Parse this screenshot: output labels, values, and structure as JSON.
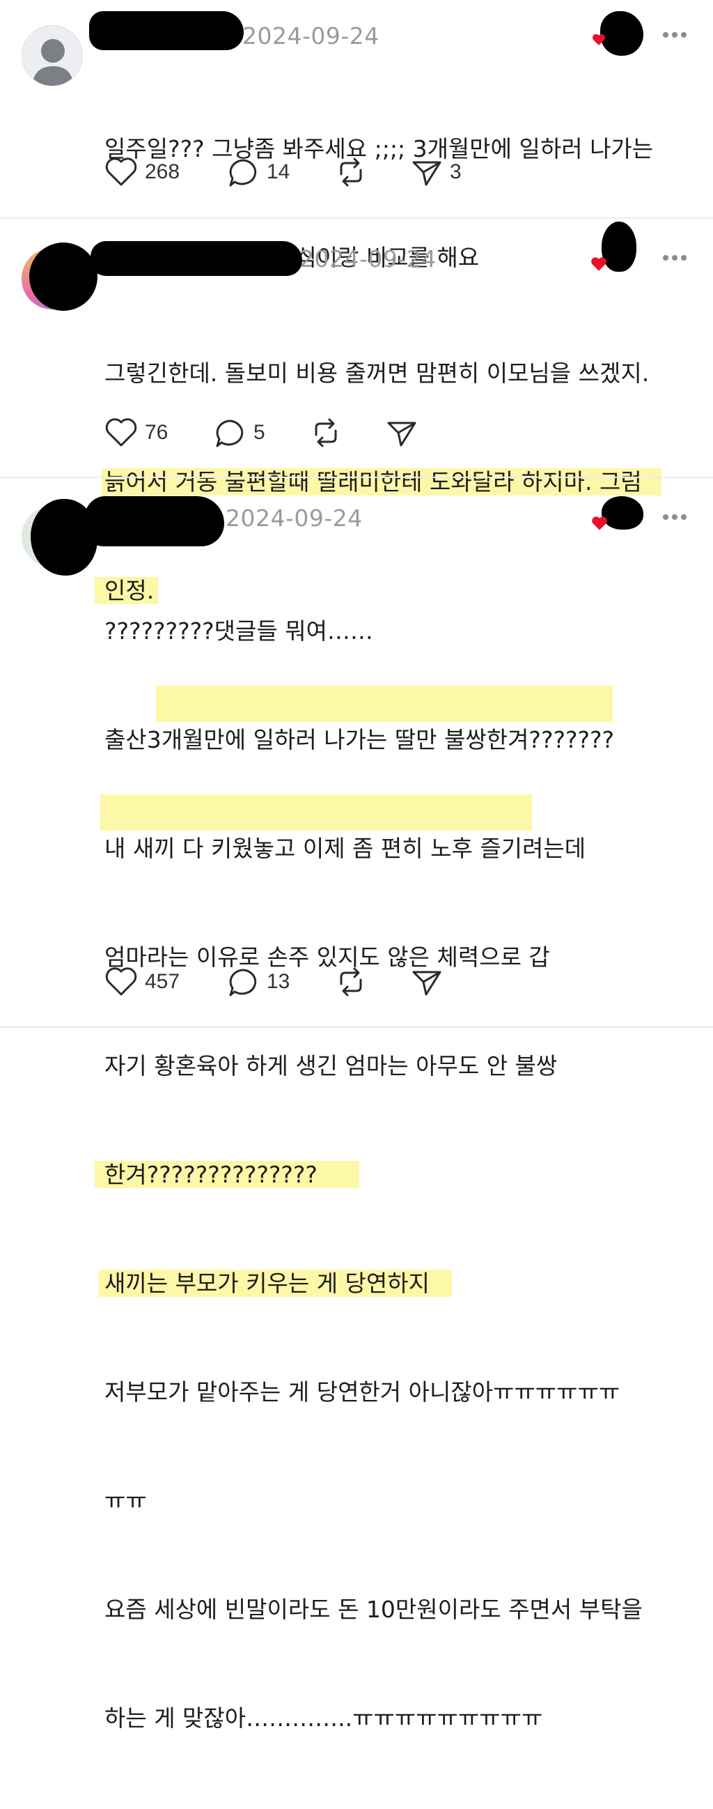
{
  "posts": [
    {
      "date": "2024-09-24",
      "lines": [
        "일주일??? 그냥좀 봐주세요 ;;;; 3개월만에 일하러 나가는",
        "데 무슨 놀러가는 자식이랑 비교를 해요"
      ],
      "likes": "268",
      "comments": "14",
      "shares": "3"
    },
    {
      "date": "2024-09-24",
      "lines": [
        "그렇긴한데. 돌보미 비용 줄꺼면 맘편히 이모님을 쓰겠지.",
        "늙어서 거동 불편할때 딸래미한테 도와달라 하지마. 그럼",
        "인정."
      ],
      "likes": "76",
      "comments": "5",
      "shares": ""
    },
    {
      "date": "2024-09-24",
      "lines": [
        "?????????댓글들 뭐여……",
        "출산3개월만에 일하러 나가는 딸만 불쌍한겨???????",
        "내 새끼 다 키웠놓고 이제 좀 편히 노후 즐기려는데",
        "엄마라는 이유로 손주 있지도 않은 체력으로 갑",
        "자기 황혼육아 하게 생긴 엄마는 아무도 안 불쌍",
        "한겨??????????????",
        "새끼는 부모가 키우는 게 당연하지",
        "저부모가 맡아주는 게 당연한거 아니잖아ㅠㅠㅠㅠㅠㅠ",
        "ㅠㅠ",
        "요즘 세상에 빈말이라도 돈 10만원이라도 주면서 부탁을",
        "하는 게 맞잖아…………..ㅠㅠㅠㅠㅠㅠㅠㅠㅠ"
      ],
      "likes": "457",
      "comments": "13",
      "shares": ""
    }
  ],
  "icons": {
    "like": "heart-outline-icon",
    "comment": "speech-bubble-icon",
    "repost": "repost-arrows-icon",
    "share": "paper-plane-icon",
    "more": "more-dots-icon"
  },
  "colors": {
    "highlight": "#fdf7a8",
    "heart_badge": "#e8102a",
    "date": "#9a9a9a"
  }
}
